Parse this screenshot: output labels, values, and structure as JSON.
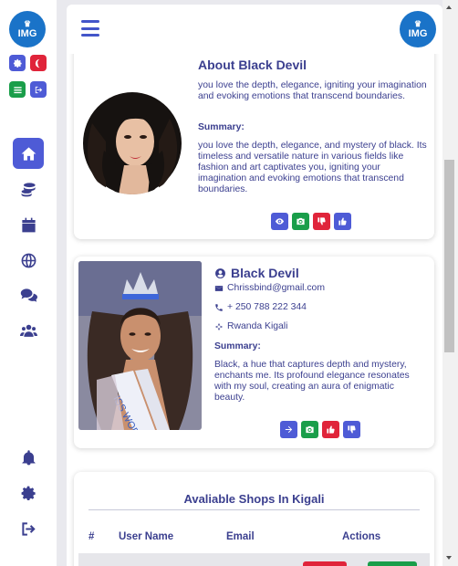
{
  "sidebar": {
    "logo_text": "IMG",
    "nav": [
      {
        "name": "home-icon",
        "active": true
      },
      {
        "name": "coins-icon",
        "active": false
      },
      {
        "name": "calendar-icon",
        "active": false
      },
      {
        "name": "globe-icon",
        "active": false
      },
      {
        "name": "comments-icon",
        "active": false
      },
      {
        "name": "users-icon",
        "active": false
      }
    ],
    "bottom": [
      "bell-icon",
      "gear-icon",
      "sign-out-icon"
    ]
  },
  "header": {
    "logo_text": "IMG"
  },
  "about_card": {
    "title": "About Black Devil",
    "intro": "you love the depth, elegance, igniting your imagination and evoking emotions that transcend boundaries.",
    "summary_label": "Summary:",
    "summary": "you love the depth, elegance, and mystery of black. Its timeless and versatile nature in various fields like fashion and art captivates you, igniting your imagination and evoking emotions that transcend boundaries.",
    "actions": [
      "eye-icon",
      "camera-icon",
      "thumbs-down-icon",
      "thumbs-up-icon"
    ]
  },
  "profile_card": {
    "name": "Black Devil",
    "email": "Chrissbind@gmail.com",
    "phone": "+ 250 788 222 344",
    "location": "Rwanda Kigali",
    "summary_label": "Summary:",
    "summary": "Black, a hue that captures depth and mystery, enchants me. Its profound elegance resonates with my soul, creating an aura of enigmatic beauty.",
    "actions": [
      "arrow-right-icon",
      "camera-icon",
      "thumbs-up-icon",
      "thumbs-down-icon"
    ]
  },
  "shops": {
    "title": "Avaliable Shops In Kigali",
    "columns": [
      "#",
      "User Name",
      "Email",
      "Actions"
    ]
  },
  "colors": {
    "primary": "#4e5bd6",
    "text": "#3b3f8f",
    "green": "#1a9e4a",
    "red": "#e0243a",
    "night": "#e0243a"
  }
}
